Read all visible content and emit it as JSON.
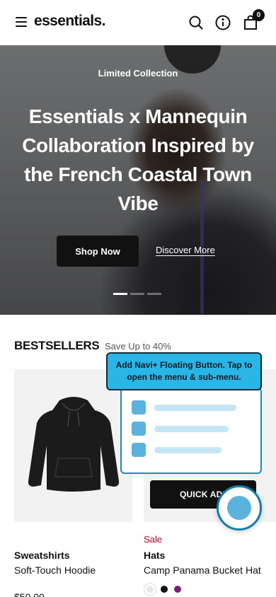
{
  "header": {
    "logo": "essentials.",
    "icons": [
      "menu-icon",
      "search-icon",
      "info-icon",
      "shopping-bag-icon"
    ],
    "cart_count": "0"
  },
  "hero": {
    "eyebrow": "Limited Collection",
    "title": "Essentials x Mannequin Collaboration Inspired by the French Coastal Town Vibe",
    "primary_button": "Shop Now",
    "secondary_link": "Discover More",
    "slides": 3,
    "active_slide": 1
  },
  "bestsellers": {
    "title": "BESTSELLERS",
    "subtitle": "Save Up to 40%",
    "quick_add_label": "QUICK ADD",
    "products": [
      {
        "category": "Sweatshirts",
        "name": "Soft-Touch Hoodie",
        "price": "$50.00",
        "sale_badge": ""
      },
      {
        "category": "Hats",
        "name": "Camp Panama Bucket Hat",
        "sale_badge": "Sale",
        "swatch_colors": [
          "#e8e8e8",
          "#111111",
          "#7b1e7a"
        ]
      }
    ]
  },
  "navi_plus": {
    "tooltip": "Add Navi+ Floating Button. Tap to open the menu & sub-menu.",
    "accent_color": "#29b6e6",
    "menu_items": 3
  }
}
